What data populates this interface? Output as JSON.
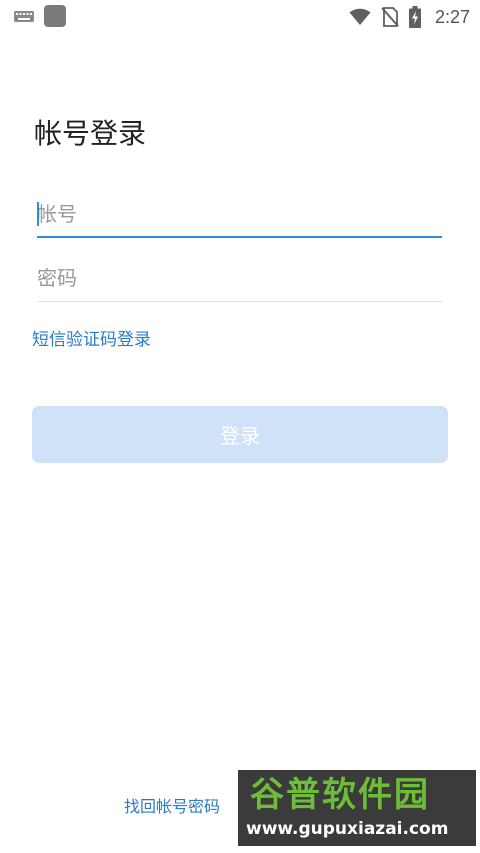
{
  "status_bar": {
    "time": "2:27",
    "icons": [
      "keyboard-icon",
      "app-square-icon",
      "wifi-icon",
      "no-sim-icon",
      "battery-charging-icon"
    ]
  },
  "login": {
    "title": "帐号登录",
    "account_placeholder": "帐号",
    "password_placeholder": "密码",
    "sms_login_label": "短信验证码登录",
    "login_button_label": "登录",
    "recover_label": "找回帐号密码"
  },
  "watermark": {
    "name": "谷普软件园",
    "url": "www.gupuxiazai.com"
  },
  "colors": {
    "accent": "#2b8fd6",
    "link": "#2a7bc8",
    "button_disabled": "#cfe2f8",
    "watermark_green": "#6ebd3a"
  }
}
